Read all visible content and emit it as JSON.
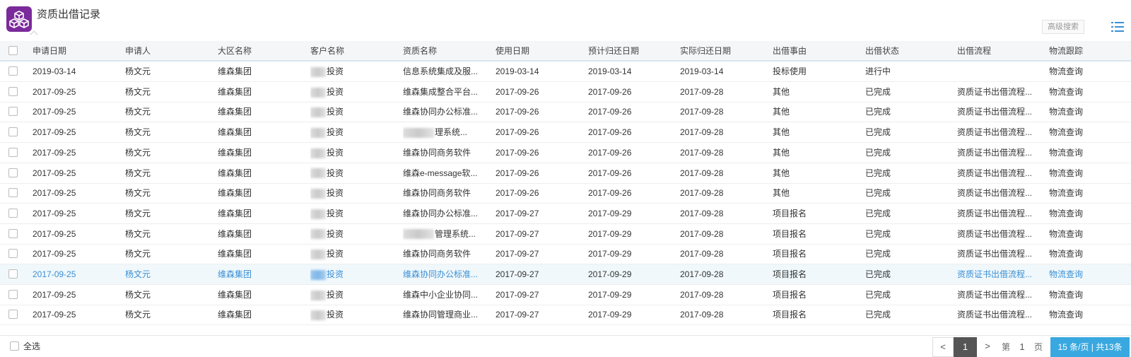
{
  "header": {
    "title": "资质出借记录",
    "advanced_search": "高级搜索"
  },
  "columns": [
    "申请日期",
    "申请人",
    "大区名称",
    "客户名称",
    "资质名称",
    "使用日期",
    "预计归还日期",
    "实际归还日期",
    "出借事由",
    "出借状态",
    "出借流程",
    "物流跟踪"
  ],
  "rows": [
    {
      "date": "2019-03-14",
      "applicant": "杨文元",
      "region": "维森集团",
      "customer": "投资",
      "qualification": "信息系统集成及服...",
      "use_date": "2019-03-14",
      "expected_return": "2019-03-14",
      "actual_return": "2019-03-14",
      "reason": "投标使用",
      "status": "进行中",
      "flow": "",
      "tracking": "物流查询"
    },
    {
      "date": "2017-09-25",
      "applicant": "杨文元",
      "region": "维森集团",
      "customer": "投资",
      "qualification": "维森集成整合平台...",
      "use_date": "2017-09-26",
      "expected_return": "2017-09-26",
      "actual_return": "2017-09-28",
      "reason": "其他",
      "status": "已完成",
      "flow": "资质证书出借流程...",
      "tracking": "物流查询"
    },
    {
      "date": "2017-09-25",
      "applicant": "杨文元",
      "region": "维森集团",
      "customer": "投资",
      "qualification": "维森协同办公标准...",
      "use_date": "2017-09-26",
      "expected_return": "2017-09-26",
      "actual_return": "2017-09-28",
      "reason": "其他",
      "status": "已完成",
      "flow": "资质证书出借流程...",
      "tracking": "物流查询"
    },
    {
      "date": "2017-09-25",
      "applicant": "杨文元",
      "region": "维森集团",
      "customer": "投资",
      "qualification": "理系统...",
      "use_date": "2017-09-26",
      "expected_return": "2017-09-26",
      "actual_return": "2017-09-28",
      "reason": "其他",
      "status": "已完成",
      "flow": "资质证书出借流程...",
      "tracking": "物流查询"
    },
    {
      "date": "2017-09-25",
      "applicant": "杨文元",
      "region": "维森集团",
      "customer": "投资",
      "qualification": "维森协同商务软件",
      "use_date": "2017-09-26",
      "expected_return": "2017-09-26",
      "actual_return": "2017-09-28",
      "reason": "其他",
      "status": "已完成",
      "flow": "资质证书出借流程...",
      "tracking": "物流查询"
    },
    {
      "date": "2017-09-25",
      "applicant": "杨文元",
      "region": "维森集团",
      "customer": "投资",
      "qualification": "维森e-message软...",
      "use_date": "2017-09-26",
      "expected_return": "2017-09-26",
      "actual_return": "2017-09-28",
      "reason": "其他",
      "status": "已完成",
      "flow": "资质证书出借流程...",
      "tracking": "物流查询"
    },
    {
      "date": "2017-09-25",
      "applicant": "杨文元",
      "region": "维森集团",
      "customer": "投资",
      "qualification": "维森协同商务软件",
      "use_date": "2017-09-26",
      "expected_return": "2017-09-26",
      "actual_return": "2017-09-28",
      "reason": "其他",
      "status": "已完成",
      "flow": "资质证书出借流程...",
      "tracking": "物流查询"
    },
    {
      "date": "2017-09-25",
      "applicant": "杨文元",
      "region": "维森集团",
      "customer": "投资",
      "qualification": "维森协同办公标准...",
      "use_date": "2017-09-27",
      "expected_return": "2017-09-29",
      "actual_return": "2017-09-28",
      "reason": "项目报名",
      "status": "已完成",
      "flow": "资质证书出借流程...",
      "tracking": "物流查询"
    },
    {
      "date": "2017-09-25",
      "applicant": "杨文元",
      "region": "维森集团",
      "customer": "投资",
      "qualification": "管理系统...",
      "use_date": "2017-09-27",
      "expected_return": "2017-09-29",
      "actual_return": "2017-09-28",
      "reason": "项目报名",
      "status": "已完成",
      "flow": "资质证书出借流程...",
      "tracking": "物流查询"
    },
    {
      "date": "2017-09-25",
      "applicant": "杨文元",
      "region": "维森集团",
      "customer": "投资",
      "qualification": "维森协同商务软件",
      "use_date": "2017-09-27",
      "expected_return": "2017-09-29",
      "actual_return": "2017-09-28",
      "reason": "项目报名",
      "status": "已完成",
      "flow": "资质证书出借流程...",
      "tracking": "物流查询"
    },
    {
      "date": "2017-09-25",
      "applicant": "杨文元",
      "region": "维森集团",
      "customer": "投资",
      "qualification": "维森协同办公标准...",
      "use_date": "2017-09-27",
      "expected_return": "2017-09-29",
      "actual_return": "2017-09-28",
      "reason": "项目报名",
      "status": "已完成",
      "flow": "资质证书出借流程...",
      "tracking": "物流查询",
      "highlighted": true
    },
    {
      "date": "2017-09-25",
      "applicant": "杨文元",
      "region": "维森集团",
      "customer": "投资",
      "qualification": "维森中小企业协同...",
      "use_date": "2017-09-27",
      "expected_return": "2017-09-29",
      "actual_return": "2017-09-28",
      "reason": "项目报名",
      "status": "已完成",
      "flow": "资质证书出借流程...",
      "tracking": "物流查询"
    },
    {
      "date": "2017-09-25",
      "applicant": "杨文元",
      "region": "维森集团",
      "customer": "投资",
      "qualification": "维森协同管理商业...",
      "use_date": "2017-09-27",
      "expected_return": "2017-09-29",
      "actual_return": "2017-09-28",
      "reason": "项目报名",
      "status": "已完成",
      "flow": "资质证书出借流程...",
      "tracking": "物流查询"
    }
  ],
  "footer": {
    "select_all": "全选",
    "prev": "<",
    "current_page": "1",
    "next": ">",
    "page_prefix": "第",
    "page_number": "1",
    "page_suffix": "页",
    "page_size": "15  条/页 | 共13条"
  },
  "colors": {
    "brand_icon": "#7a2a9a",
    "highlight_text": "#3a8fd6",
    "page_size_bg": "#3aa8e0",
    "current_page_bg": "#555555"
  }
}
